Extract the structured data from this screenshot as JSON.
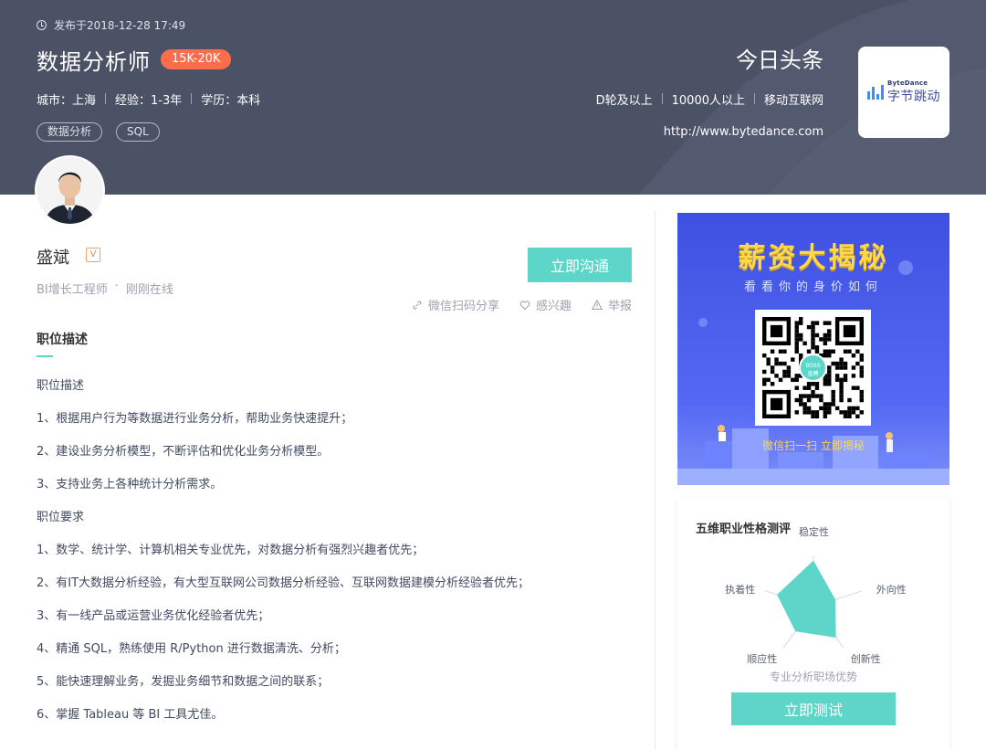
{
  "job": {
    "posted": "发布于2018-12-28 17:49",
    "title": "数据分析师",
    "salary": "15K-20K",
    "city": "城市：上海",
    "experience": "经验：1-3年",
    "education": "学历：本科",
    "tags": [
      "数据分析",
      "SQL"
    ]
  },
  "company": {
    "name": "今日头条",
    "stage": "D轮及以上",
    "size": "10000人以上",
    "industry": "移动互联网",
    "url": "http://www.bytedance.com",
    "logo_small": "ByteDance",
    "logo_big": "字节跳动"
  },
  "boss": {
    "name": "盛斌",
    "badge": "V",
    "title": "BI增长工程师",
    "dot": "·",
    "status": "刚刚在线"
  },
  "actions": {
    "chat": "立即沟通",
    "share": "微信扫码分享",
    "interest": "感兴趣",
    "report": "举报"
  },
  "description": {
    "section_title": "职位描述",
    "lines": [
      "职位描述",
      "1、根据用户行为等数据进行业务分析，帮助业务快速提升；",
      "2、建设业务分析模型，不断评估和优化业务分析模型。",
      "3、支持业务上各种统计分析需求。",
      "职位要求",
      "1、数学、统计学、计算机相关专业优先，对数据分析有强烈兴趣者优先；",
      "2、有IT大数据分析经验，有大型互联网公司数据分析经验、互联网数据建模分析经验者优先；",
      "3、有一线产品或运营业务优化经验者优先；",
      "4、精通 SQL，熟练使用 R/Python 进行数据清洗、分析；",
      "5、能快速理解业务，发掘业务细节和数据之间的联系；",
      "6、掌握 Tableau 等 BI 工具尤佳。"
    ]
  },
  "ad": {
    "title": "薪资大揭秘",
    "subtitle": "看看你的身价如何",
    "qr_brand_top": "BOSS",
    "qr_brand_bottom": "直聘",
    "scan_hint": "微信扫一扫  立即揭秘"
  },
  "test": {
    "title": "五维职业性格测评",
    "labels": [
      "稳定性",
      "外向性",
      "创新性",
      "顺应性",
      "执着性"
    ],
    "values": [
      0.9,
      0.45,
      0.75,
      0.6,
      0.75
    ],
    "caption": "专业分析职场优势",
    "button": "立即测试",
    "fill_color": "#5dd5c8"
  }
}
